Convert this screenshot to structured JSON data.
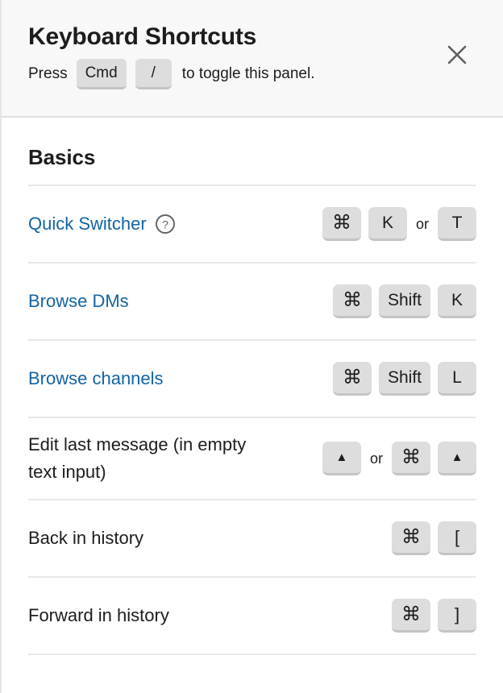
{
  "header": {
    "title": "Keyboard Shortcuts",
    "subtitle_prefix": "Press",
    "subtitle_key_1": "Cmd",
    "subtitle_key_2": "/",
    "subtitle_suffix": "to toggle this panel.",
    "close_icon": "close-icon",
    "background_color": "#f8f8f8"
  },
  "colors": {
    "link": "#1264a3",
    "text": "#1d1c1d",
    "key_background": "#dddddd",
    "divider": "#e8e8e8"
  },
  "sections": [
    {
      "title": "Basics",
      "rows": [
        {
          "label": "Quick Switcher",
          "is_link": true,
          "has_help_icon": true,
          "help_icon": "help-circle-icon",
          "keys": [
            {
              "type": "key",
              "label": "⌘",
              "name": "command"
            },
            {
              "type": "key",
              "label": "K",
              "name": "k"
            },
            {
              "type": "text",
              "label": "or"
            },
            {
              "type": "key",
              "label": "T",
              "name": "t"
            }
          ]
        },
        {
          "label": "Browse DMs",
          "is_link": true,
          "has_help_icon": false,
          "keys": [
            {
              "type": "key",
              "label": "⌘",
              "name": "command"
            },
            {
              "type": "key",
              "label": "Shift",
              "name": "shift"
            },
            {
              "type": "key",
              "label": "K",
              "name": "k"
            }
          ]
        },
        {
          "label": "Browse channels",
          "is_link": true,
          "has_help_icon": false,
          "keys": [
            {
              "type": "key",
              "label": "⌘",
              "name": "command"
            },
            {
              "type": "key",
              "label": "Shift",
              "name": "shift"
            },
            {
              "type": "key",
              "label": "L",
              "name": "l"
            }
          ]
        },
        {
          "label": "Edit last message (in empty text input)",
          "is_link": false,
          "has_help_icon": false,
          "keys": [
            {
              "type": "key",
              "label": "▲",
              "name": "arrow-up"
            },
            {
              "type": "text",
              "label": "or"
            },
            {
              "type": "key",
              "label": "⌘",
              "name": "command"
            },
            {
              "type": "key",
              "label": "▲",
              "name": "arrow-up"
            }
          ]
        },
        {
          "label": "Back in history",
          "is_link": false,
          "has_help_icon": false,
          "keys": [
            {
              "type": "key",
              "label": "⌘",
              "name": "command"
            },
            {
              "type": "key",
              "label": "[",
              "name": "bracket-left"
            }
          ]
        },
        {
          "label": "Forward in history",
          "is_link": false,
          "has_help_icon": false,
          "keys": [
            {
              "type": "key",
              "label": "⌘",
              "name": "command"
            },
            {
              "type": "key",
              "label": "]",
              "name": "bracket-right"
            }
          ]
        }
      ]
    }
  ]
}
